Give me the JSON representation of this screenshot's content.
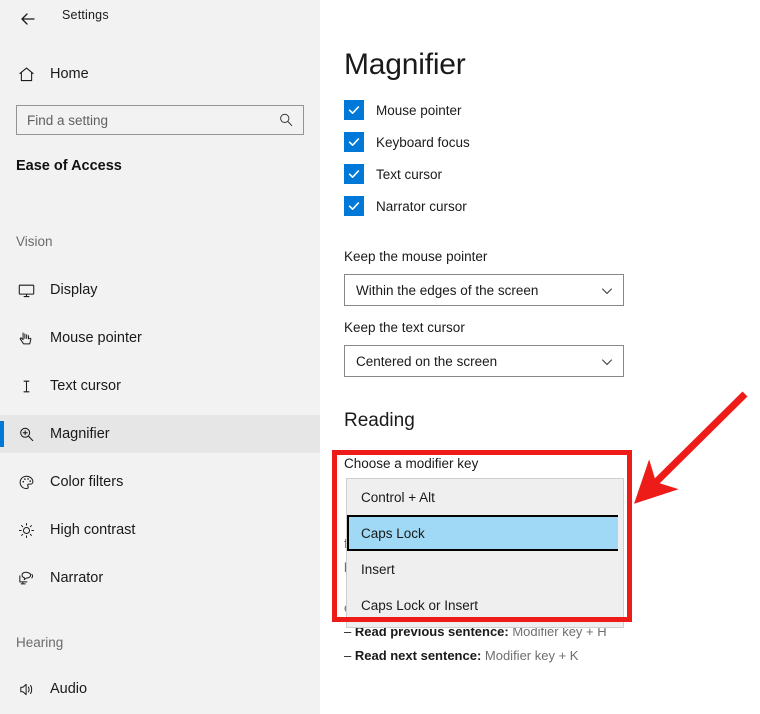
{
  "window": {
    "title": "Settings",
    "back_icon": "back-arrow-icon"
  },
  "sidebar": {
    "home": {
      "label": "Home",
      "icon": "home-icon"
    },
    "search": {
      "placeholder": "Find a setting",
      "value": "",
      "icon": "search-icon"
    },
    "category": "Ease of Access",
    "groups": [
      {
        "title": "Vision",
        "items": [
          {
            "label": "Display",
            "icon": "monitor-icon",
            "selected": false
          },
          {
            "label": "Mouse pointer",
            "icon": "pointer-hand-icon",
            "selected": false
          },
          {
            "label": "Text cursor",
            "icon": "text-caret-icon",
            "selected": false
          },
          {
            "label": "Magnifier",
            "icon": "magnifier-plus-icon",
            "selected": true
          },
          {
            "label": "Color filters",
            "icon": "palette-icon",
            "selected": false
          },
          {
            "label": "High contrast",
            "icon": "sun-icon",
            "selected": false
          },
          {
            "label": "Narrator",
            "icon": "narrator-speech-icon",
            "selected": false
          }
        ]
      },
      {
        "title": "Hearing",
        "items": [
          {
            "label": "Audio",
            "icon": "speaker-icon",
            "selected": false
          }
        ]
      }
    ]
  },
  "main": {
    "page_title": "Magnifier",
    "checkboxes": [
      {
        "label": "Mouse pointer",
        "checked": true
      },
      {
        "label": "Keyboard focus",
        "checked": true
      },
      {
        "label": "Text cursor",
        "checked": true
      },
      {
        "label": "Narrator cursor",
        "checked": true
      }
    ],
    "fields": [
      {
        "label": "Keep the mouse pointer",
        "value": "Within the edges of the screen"
      },
      {
        "label": "Keep the text cursor",
        "value": "Centered on the screen"
      }
    ],
    "reading_heading": "Reading",
    "reading_lines": [
      {
        "text": "from your screen:",
        "bold": ""
      },
      {
        "text": "key + Enter",
        "bold": ""
      },
      {
        "text": "eft Mouse Click",
        "bold": ""
      },
      {
        "bold": "Read previous sentence:",
        "text": " Modifier key + H"
      },
      {
        "bold": "Read next sentence:",
        "text": " Modifier key + K"
      }
    ]
  },
  "dropdown": {
    "label": "Choose a modifier key",
    "open": true,
    "selected": "Caps Lock",
    "options": [
      "Control + Alt",
      "Caps Lock",
      "Insert",
      "Caps Lock or Insert"
    ]
  },
  "annotation": {
    "color": "#ee1c18",
    "box_label": "highlight-box",
    "arrow_label": "pointer-arrow"
  }
}
